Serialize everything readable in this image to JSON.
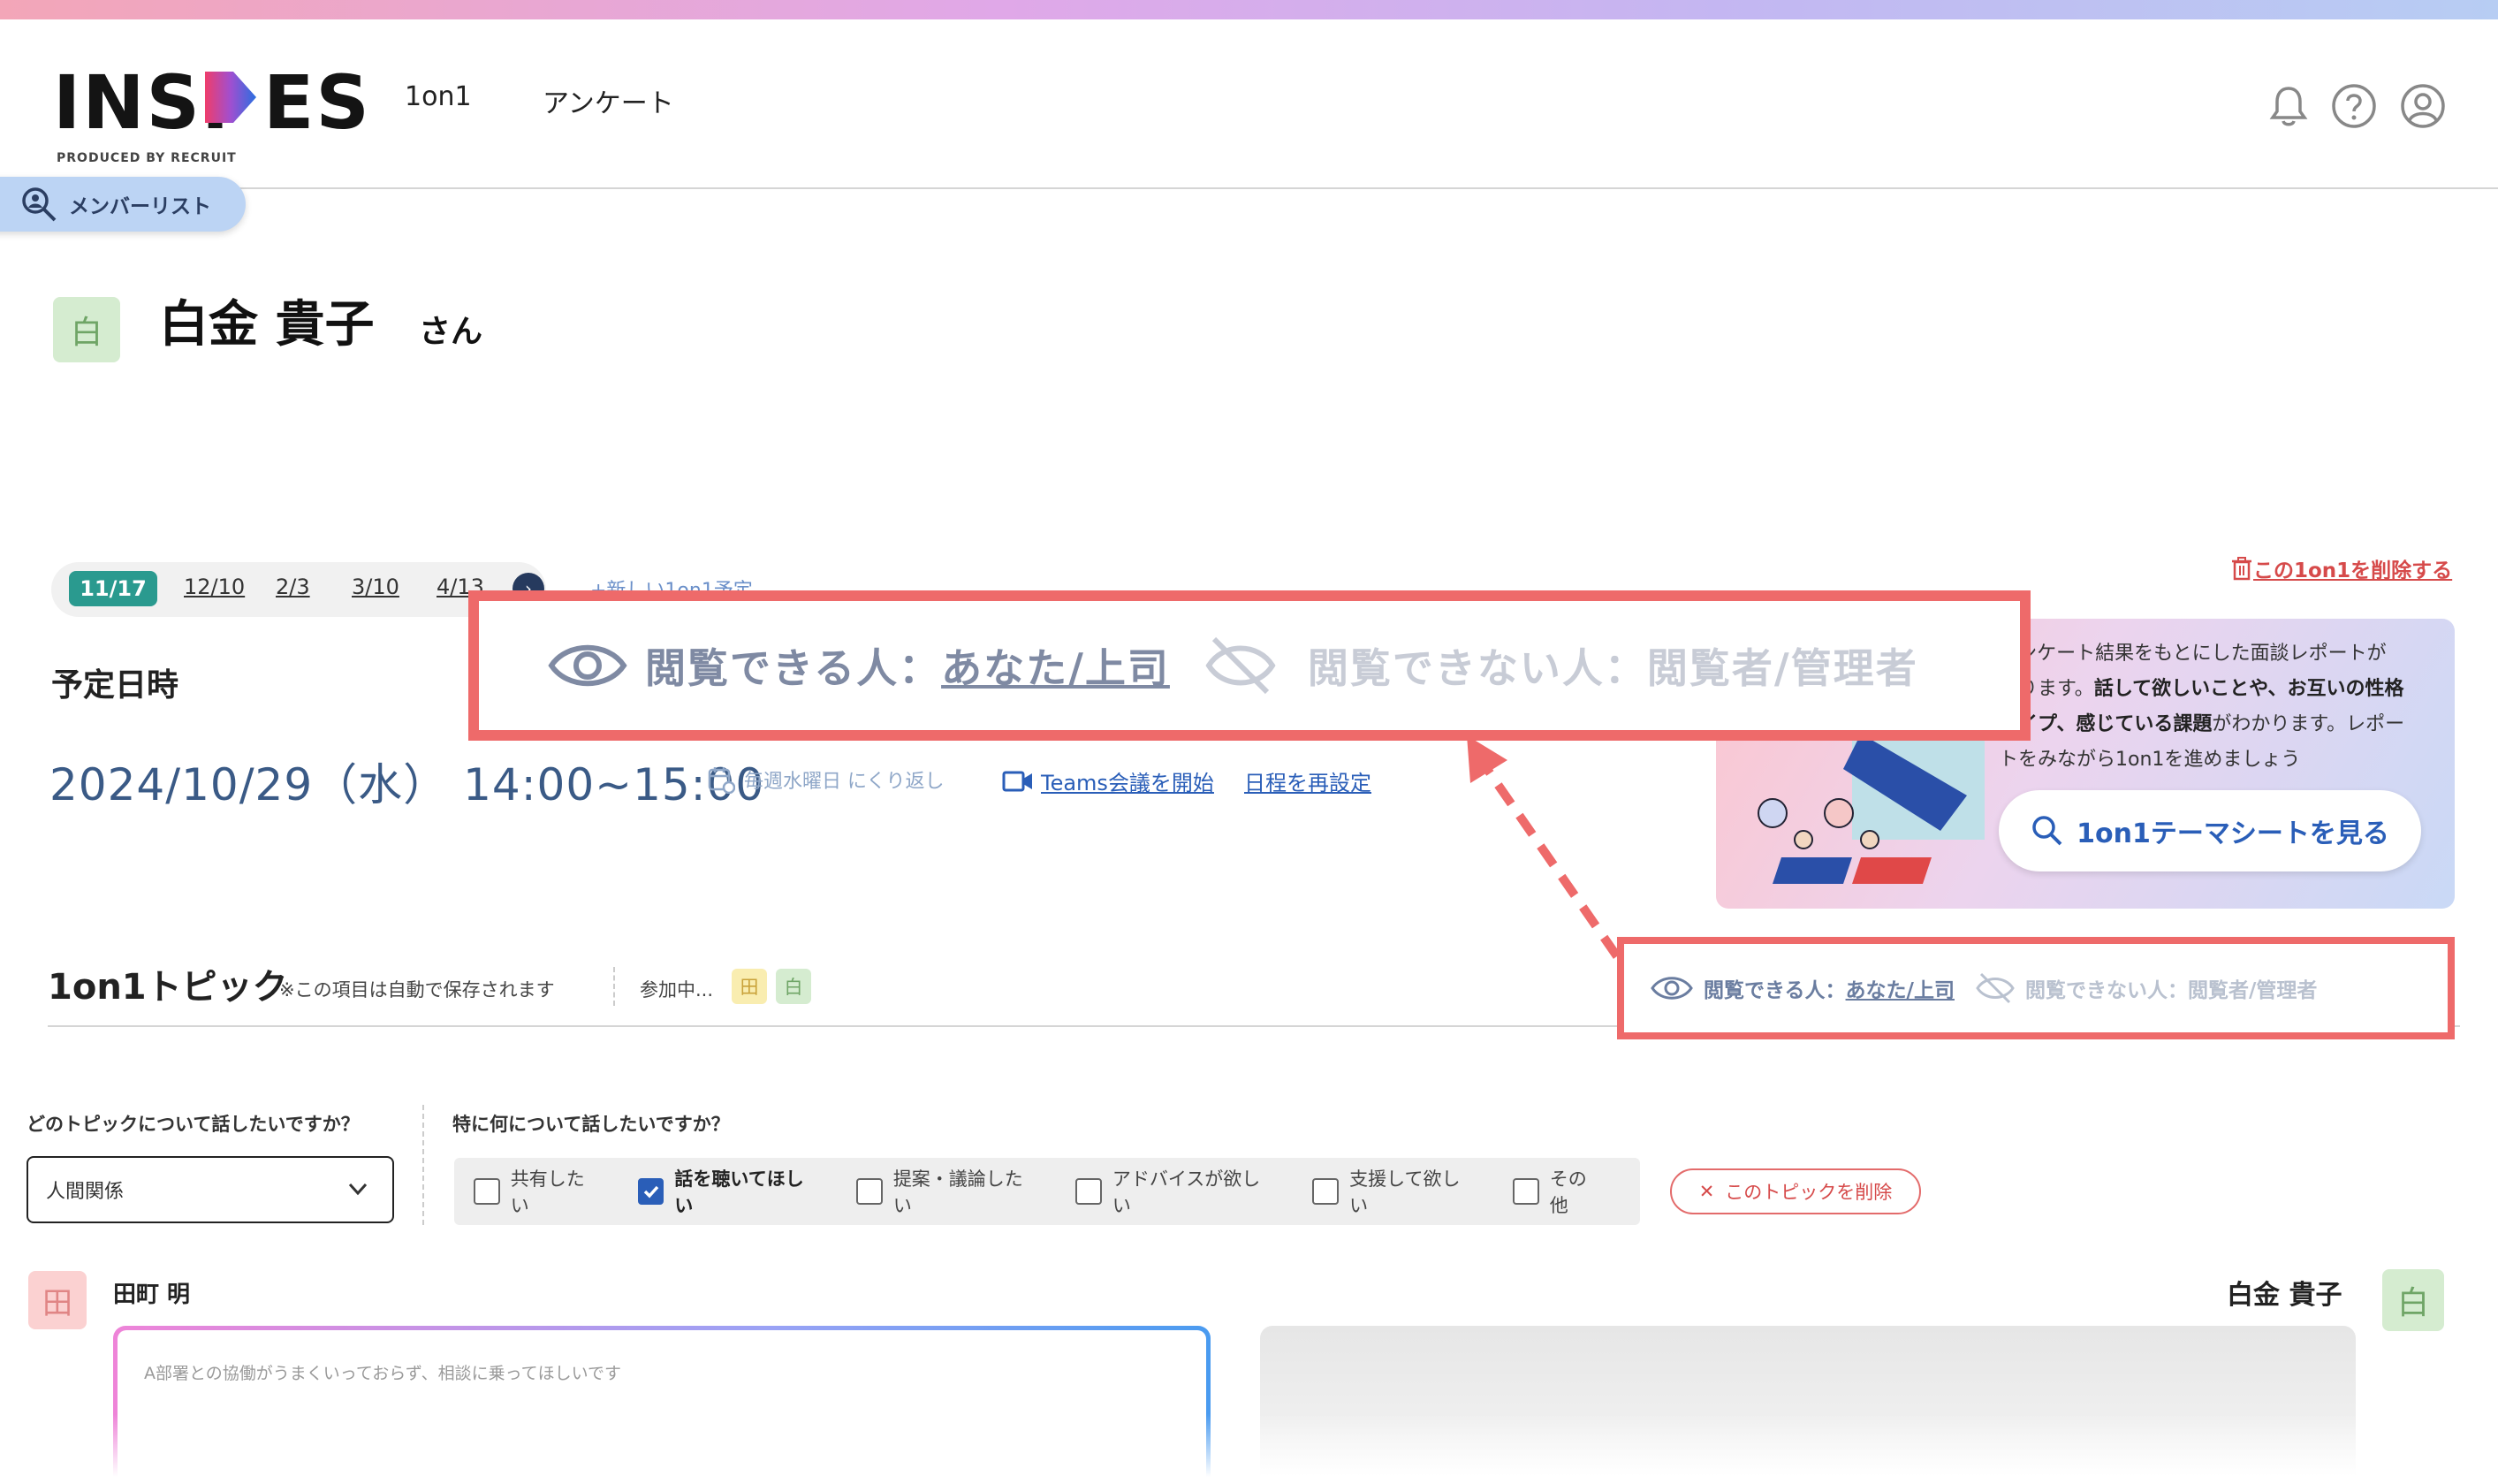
{
  "app": {
    "logo_text_left": "INSI",
    "logo_text_right": "ES",
    "logo_sub": "PRODUCED BY RECRUIT"
  },
  "nav": {
    "item1": "1on1",
    "item2": "アンケート"
  },
  "header_icons": [
    "bell-icon",
    "help-icon",
    "user-icon"
  ],
  "member_list": {
    "label": "メンバーリスト"
  },
  "profile": {
    "avatar": "白",
    "name": "白金 貴子",
    "suffix": "さん"
  },
  "dates": {
    "tabs": [
      "11/17",
      "12/10",
      "2/3",
      "3/10",
      "4/13"
    ],
    "active": "11/17",
    "new_label": "+新しい1on1予定",
    "delete_label": "この1on1を削除する"
  },
  "schedule": {
    "label": "予定日時",
    "datetime": "2024/10/29（水） 14:00~15:00",
    "repeat": "毎週水曜日 にくり返し",
    "teams": "Teams会議を開始",
    "reschedule": "日程を再設定"
  },
  "promo": {
    "line1": "アンケート結果をもとにした面談レポートが",
    "line2a": "あります。",
    "line2b": "話して欲しいことや、お互いの性格",
    "line3a": "タイプ、感じている課題",
    "line3b": "がわかります。レポー",
    "line4": "トをみながら1on1を進めましょう",
    "button": "1on1テーマシートを見る"
  },
  "topics": {
    "title": "1on1トピック",
    "autosave": "※この項目は自動で保存されます",
    "attending": "参加中...",
    "attendees": [
      "田",
      "白"
    ]
  },
  "visibility": {
    "can_prefix": "閲覧できる人：",
    "can_value": "あなた/上司",
    "cannot": "閲覧できない人：閲覧者/管理者"
  },
  "topic_form": {
    "q1": "どのトピックについて話したいですか？",
    "q2": "特に何について話したいですか？",
    "selected_topic": "人間関係",
    "options": [
      {
        "label": "共有したい",
        "checked": false
      },
      {
        "label": "話を聴いてほしい",
        "checked": true
      },
      {
        "label": "提案・議論したい",
        "checked": false
      },
      {
        "label": "アドバイスが欲しい",
        "checked": false
      },
      {
        "label": "支援して欲しい",
        "checked": false
      },
      {
        "label": "その他",
        "checked": false
      }
    ],
    "delete_topic": "このトピックを削除"
  },
  "comments": {
    "left_avatar": "田",
    "left_name": "田町 明",
    "left_text": "A部署との協働がうまくいっておらず、相談に乗ってほしいです",
    "right_name": "白金 貴子",
    "right_avatar": "白"
  },
  "colors": {
    "accent": "#2a5eb8",
    "teal": "#2a9a8f",
    "highlight_border": "#ee6a6a",
    "danger": "#d64a4a"
  }
}
